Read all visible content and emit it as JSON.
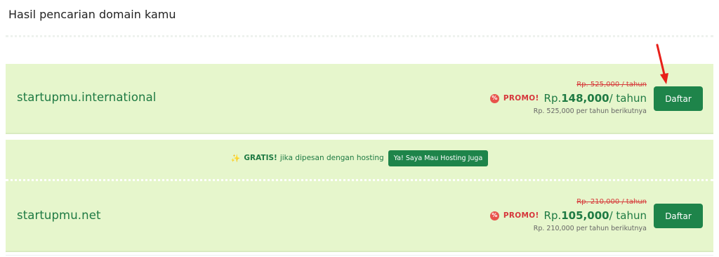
{
  "heading": "Hasil pencarian domain kamu",
  "results": [
    {
      "domain": "startupmu.international",
      "old_price": "Rp. 525,000 / tahun",
      "promo_label": "PROMO!",
      "currency": "Rp.",
      "price": "148,000",
      "period": "/ tahun",
      "renewal": "Rp. 525,000 per tahun berikutnya",
      "button": "Daftar"
    },
    {
      "domain": "startupmu.net",
      "old_price": "Rp. 210,000 / tahun",
      "promo_label": "PROMO!",
      "currency": "Rp.",
      "price": "105,000",
      "period": "/ tahun",
      "renewal": "Rp. 210,000 per tahun berikutnya",
      "button": "Daftar"
    }
  ],
  "hosting_offer": {
    "strong": "GRATIS!",
    "text": "jika dipesan dengan hosting",
    "button": "Ya! Saya Mau Hosting Juga"
  },
  "colors": {
    "card_bg": "#e6f6cc",
    "brand_green": "#1e844a",
    "promo_red": "#d6363b",
    "arrow_red": "#e8201a"
  },
  "icons": {
    "promo": "promo-badge-icon",
    "gratis": "sparkle-icon",
    "annotation": "red-arrow-icon"
  }
}
